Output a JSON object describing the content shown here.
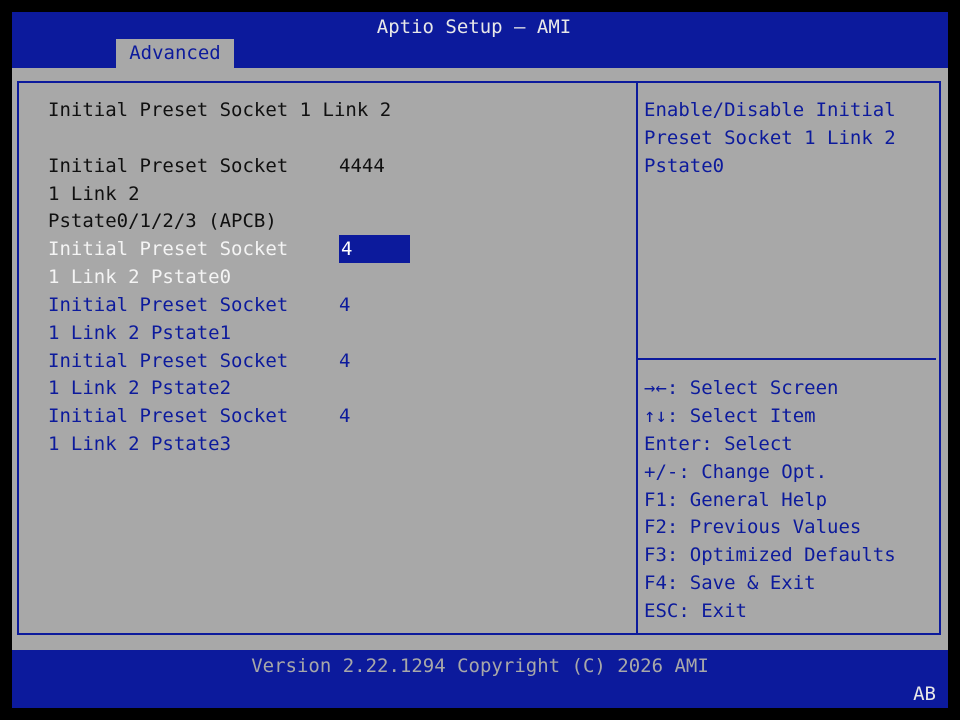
{
  "header": {
    "title": "Aptio Setup – AMI",
    "active_tab": "Advanced"
  },
  "main": {
    "section_title": "Initial Preset Socket 1 Link 2",
    "info_item": {
      "label_lines": [
        "Initial Preset Socket",
        "1 Link 2",
        "Pstate0/1/2/3 (APCB)"
      ],
      "value": "4444"
    },
    "options": [
      {
        "label_lines": [
          "Initial Preset Socket",
          "1 Link 2 Pstate0"
        ],
        "value": "4",
        "selected": true
      },
      {
        "label_lines": [
          "Initial Preset Socket",
          "1 Link 2 Pstate1"
        ],
        "value": "4",
        "selected": false
      },
      {
        "label_lines": [
          "Initial Preset Socket",
          "1 Link 2 Pstate2"
        ],
        "value": "4",
        "selected": false
      },
      {
        "label_lines": [
          "Initial Preset Socket",
          "1 Link 2 Pstate3"
        ],
        "value": "4",
        "selected": false
      }
    ]
  },
  "help": {
    "lines": [
      "Enable/Disable Initial",
      "Preset Socket 1 Link 2",
      "Pstate0"
    ]
  },
  "keys": {
    "items": [
      {
        "key": "→←:",
        "desc": " Select Screen"
      },
      {
        "key": "↑↓:",
        "desc": " Select Item"
      },
      {
        "key": "Enter:",
        "desc": " Select"
      },
      {
        "key": "+/-:",
        "desc": " Change Opt."
      },
      {
        "key": "F1:",
        "desc": " General Help"
      },
      {
        "key": "F2:",
        "desc": " Previous Values"
      },
      {
        "key": "F3:",
        "desc": " Optimized Defaults"
      },
      {
        "key": "F4:",
        "desc": " Save & Exit"
      },
      {
        "key": "ESC:",
        "desc": " Exit"
      }
    ]
  },
  "footer": {
    "version": "Version 2.22.1294 Copyright (C) 2026 AMI",
    "corner": "AB"
  },
  "colors": {
    "bar_blue": "#0c1a9c",
    "panel_gray": "#a8a8a8",
    "selected_text": "#f4f4f4",
    "static_text": "#101010"
  }
}
